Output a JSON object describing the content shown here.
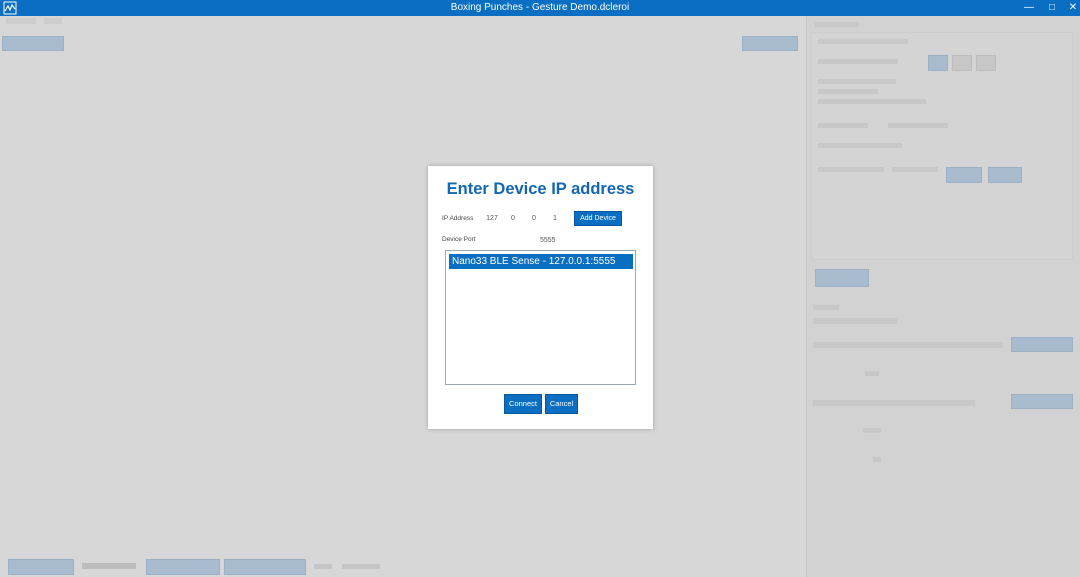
{
  "window": {
    "title": "Boxing Punches - Gesture Demo.dcleroi",
    "minimize_glyph": "—",
    "maximize_glyph": "□",
    "close_glyph": "✕"
  },
  "dialog": {
    "title": "Enter Device IP address",
    "ip_label": "IP Address",
    "ip_octets": [
      "127",
      "0",
      "0",
      "1"
    ],
    "add_button": "Add Device",
    "port_label": "Device Port",
    "port_value": "5555",
    "devices": [
      "Nano33 BLE Sense - 127.0.0.1:5555"
    ],
    "connect_button": "Connect",
    "cancel_button": "Cancel"
  },
  "colors": {
    "accent": "#0a6fc2",
    "title_blue": "#1366b2"
  },
  "icons": {
    "app": "app-logo-icon"
  }
}
